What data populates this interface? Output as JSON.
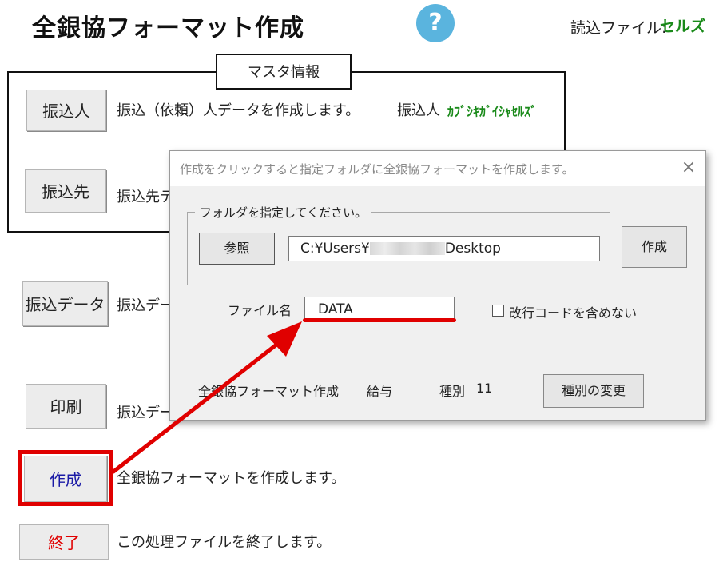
{
  "header": {
    "title": "全銀協フォーマット作成",
    "help_icon": "?",
    "read_file_label": "読込ファイル:",
    "read_file_value": "セルズ"
  },
  "master": {
    "legend": "マスタ情報",
    "rows": [
      {
        "button": "振込人",
        "desc": "振込（依頼）人データを作成します。",
        "extra_label": "振込人",
        "extra_value": "ｶﾌﾞｼｷｶﾞｲｼｬｾﾙｽﾞ"
      },
      {
        "button": "振込先",
        "desc": "振込先デ"
      }
    ]
  },
  "actions": [
    {
      "button": "振込データ",
      "desc": "振込デー"
    },
    {
      "button": "印刷",
      "desc": "振込デー"
    },
    {
      "button": "作成",
      "desc": "全銀協フォーマットを作成します。"
    },
    {
      "button": "終了",
      "desc": "この処理ファイルを終了します。"
    }
  ],
  "colors": {
    "create_button_text": "#1a1aa6",
    "exit_button_text": "#e00000",
    "highlight": "#e00000",
    "green": "#1a8a1a",
    "help": "#5ab4de"
  },
  "dialog": {
    "title": "作成をクリックすると指定フォルダに全銀協フォーマットを作成します。",
    "close_icon": "×",
    "folder_group_label": "フォルダを指定してください。",
    "browse_button": "参照",
    "path_prefix": "C:¥Users¥",
    "path_suffix": "Desktop",
    "create_button": "作成",
    "filename_label": "ファイル名",
    "filename_value": "DATA",
    "checkbox_label": "改行コードを含めない",
    "footer": {
      "format_label": "全銀協フォーマット作成",
      "type_value": "給与",
      "kind_label": "種別",
      "kind_value": "11",
      "change_kind_button": "種別の変更"
    }
  }
}
